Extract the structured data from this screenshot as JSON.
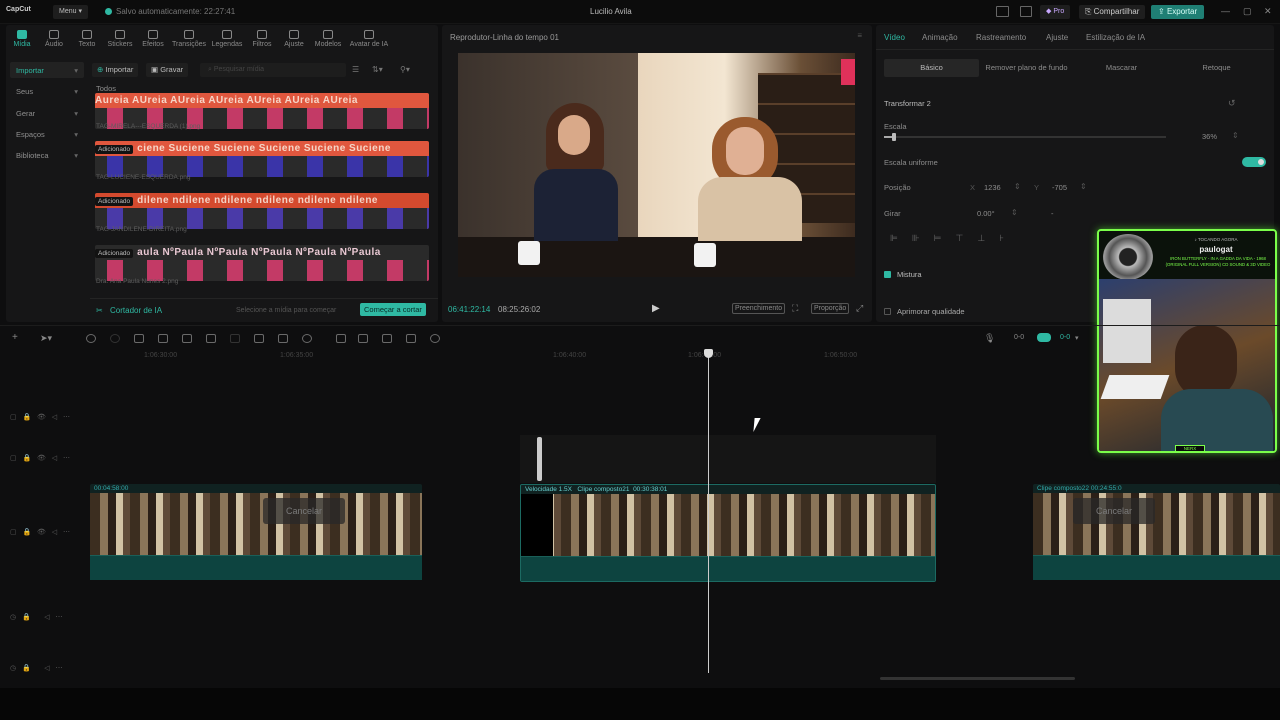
{
  "app": {
    "logo": "CapCut",
    "menu": "Menu",
    "saved": "Salvo automaticamente: 22:27:41",
    "title": "Lucilio Avila",
    "pro": "Pro",
    "share": "Compartilhar",
    "export": "Exportar"
  },
  "media": {
    "categories": [
      "Mídia",
      "Áudio",
      "Texto",
      "Stickers",
      "Efeitos",
      "Transições",
      "Legendas",
      "Filtros",
      "Ajuste",
      "Modelos",
      "Avatar de IA"
    ],
    "side": [
      "Importar",
      "Seus",
      "Gerar",
      "Espaços",
      "Biblioteca"
    ],
    "import": "Importar",
    "record": "Gravar",
    "search_placeholder": "Pesquisar mídia",
    "todos": "Todos",
    "items": [
      {
        "band": "Aureia AUreia AUreia AUreia AUreia AUreia AUreia",
        "file": "TAG-MIRELA---ESQUERDA (1).png",
        "added": ""
      },
      {
        "band": "ciene Suciene Suciene Suciene Suciene Suciene",
        "file": "TAG-LUCIENE-ESQUERDA.png",
        "added": "Adicionado"
      },
      {
        "band": "dilene ndilene ndilene ndilene ndilene ndilene",
        "file": "TAG-JANDILENE-DIREITA.png",
        "added": "Adicionado"
      },
      {
        "band": "aula NºPaula NºPaula NºPaula NºPaula NºPaula",
        "file": "Dra. Ana Paula Nunes 2.png",
        "added": "Adicionado"
      }
    ],
    "cut_label": "Cortador de IA",
    "cut_hint": "Selecione a mídia para começar",
    "cut_button": "Começar a cortar"
  },
  "player": {
    "title": "Reprodutor-Linha do tempo 01",
    "time_current": "06:41:22:14",
    "time_total": "08:25:26:02",
    "fill": "Preenchimento",
    "ratio": "Proporção"
  },
  "inspector": {
    "tabs": [
      "Vídeo",
      "Animação",
      "Rastreamento",
      "Ajuste",
      "Estilização de IA"
    ],
    "subtabs": [
      "Básico",
      "Remover plano de fundo",
      "Mascarar",
      "Retoque"
    ],
    "transform": "Transformar 2",
    "scale": "Escala",
    "scale_val": "36%",
    "uniform": "Escala uniforme",
    "position": "Posição",
    "pos_x_label": "X",
    "pos_x": "1236",
    "pos_y_label": "Y",
    "pos_y": "-705",
    "rotate": "Girar",
    "rotate_val": "0.00°",
    "rotate_dash": "-",
    "blend": "Mistura",
    "enhance": "Aprimorar qualidade",
    "scale_fraction": 0.36
  },
  "overlay": {
    "playing": "♪ TOCANDO AGORA",
    "channel": "paulogat",
    "track": "IRON BUTTERFLY - IN A GADDA DA VIDA - 1968 (ORIGINAL FULL VERSION) CD SOUND & 3D VIDEO",
    "tag": "NERX"
  },
  "timeline": {
    "ruler": [
      "1:06:30:00",
      "1:06:35:00",
      "1:06:40:00",
      "1:06:45:00",
      "1:06:50:00"
    ],
    "clip1": "00:04:58:00",
    "clip2_speed": "Velocidade 1.5X",
    "clip2_name": "Clipe composto21",
    "clip2_dur": "00:30:38:01",
    "clip3": "Clipe composto22  00:24:55:0",
    "cancel": "Cancelar",
    "zoom_a": "0-0",
    "zoom_b": "0-0"
  },
  "colors": {
    "accent": "#2fb9a3",
    "overlay_border": "#7bff4a"
  }
}
